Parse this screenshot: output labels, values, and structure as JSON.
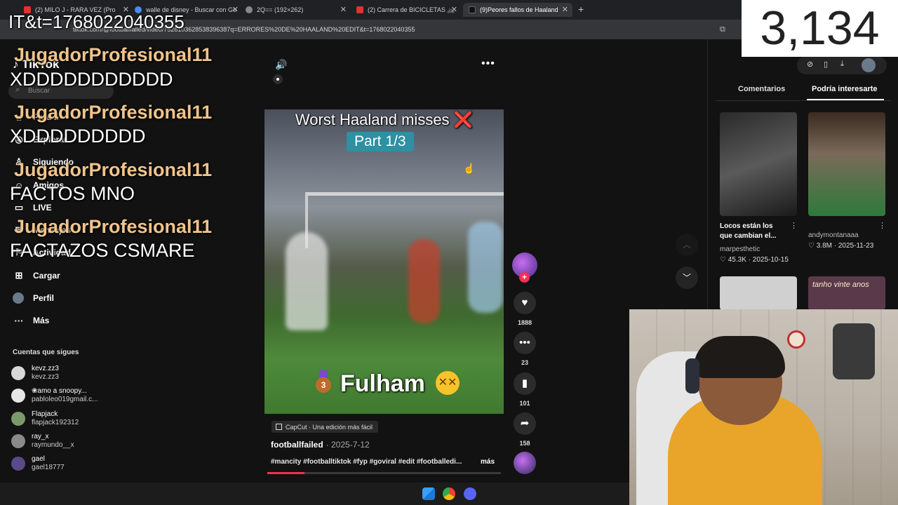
{
  "browser": {
    "tabs": [
      {
        "title": "(2) MILO J - RARA VEZ (Pro",
        "fav": "#e2322d"
      },
      {
        "title": "walle de disney - Buscar con Go",
        "fav": "#4a8af4"
      },
      {
        "title": "2Q== (192×262)",
        "fav": "#888888"
      },
      {
        "title": "(2) Carrera de BICICLETAS 🚲",
        "fav": "#e2322d"
      },
      {
        "title": "(9)Peores fallos de Haaland",
        "fav": "#111111"
      }
    ],
    "url": "tiktok.com/@footballfailed/video/7526103628538396387q=ERRORES%20DE%20HAALAND%20EDIT&t=1768022040355"
  },
  "sidebar": {
    "logo": "TikTok",
    "search_placeholder": "Buscar",
    "nav": [
      {
        "label": "Para ti",
        "icon": "home-icon"
      },
      {
        "label": "Explorar",
        "icon": "compass-icon"
      },
      {
        "label": "Siguiendo",
        "icon": "following-icon"
      },
      {
        "label": "Amigos",
        "icon": "friends-icon"
      },
      {
        "label": "LIVE",
        "icon": "live-icon"
      },
      {
        "label": "Mensajes",
        "icon": "messages-icon"
      },
      {
        "label": "Actividad",
        "icon": "activity-icon"
      },
      {
        "label": "Cargar",
        "icon": "upload-icon"
      },
      {
        "label": "Perfil",
        "icon": "profile-icon"
      },
      {
        "label": "Más",
        "icon": "more-icon"
      }
    ],
    "following_header": "Cuentas que sigues",
    "following": [
      {
        "name": "kevz.zz3",
        "handle": "kevz.zz3",
        "color": "#d8d8d8"
      },
      {
        "name": "❀amo a snoopy...",
        "handle": "pabloleo019gmail.c...",
        "color": "#e6e6e6"
      },
      {
        "name": "Flapjack",
        "handle": "flapjack192312",
        "color": "#7a9a6a"
      },
      {
        "name": "ray_x",
        "handle": "raymundo__x",
        "color": "#8a8a8a"
      },
      {
        "name": "gael",
        "handle": "gael18777",
        "color": "#5a4a8a"
      }
    ]
  },
  "chat": {
    "top_line": "IT&t=1768022040355",
    "messages": [
      {
        "user": "JugadorProfesional11",
        "text": "XDDDDDDDDDDD"
      },
      {
        "user": "JugadorProfesional11",
        "text": "XDDDDDDDDD"
      },
      {
        "user": "JugadorProfesional11",
        "text": "FACTOS MNO"
      },
      {
        "user": "JugadorProfesional11",
        "text": "FACTAZOS CSMARE"
      }
    ]
  },
  "video": {
    "title": "Worst Haaland misses",
    "title_mark": "❌",
    "part": "Part 1/3",
    "team": "Fulham",
    "medal_number": "3",
    "capcut": "CapCut · Una edición más fácil",
    "author": "footballfailed",
    "date": "· 2025-7-12",
    "tags": "#mancity #footballtiktok #fyp #goviral #edit #footballedi...",
    "more": "más",
    "progress": 0.16
  },
  "actions": {
    "likes": "1888",
    "comments": "23",
    "saves": "101",
    "shares": "158"
  },
  "right_panel": {
    "tabs": [
      "Comentarios",
      "Podría interesarte"
    ],
    "active_tab": 1,
    "items": [
      {
        "caption1": "Locos están los",
        "caption2": "que cambian el...",
        "author": "marpesthetic",
        "stats": "♡ 45.3K · 2025-10-15"
      },
      {
        "caption1": "",
        "caption2": "",
        "author": "andymontanaaa",
        "stats": "♡ 3.8M · 2025-11-23"
      }
    ],
    "thumb_overlay_text": "tanho vinte anos"
  },
  "viewer_count": "3,134",
  "colors": {
    "accent": "#fe2c55",
    "chat_user": "#f1c48a",
    "background": "#121212"
  }
}
